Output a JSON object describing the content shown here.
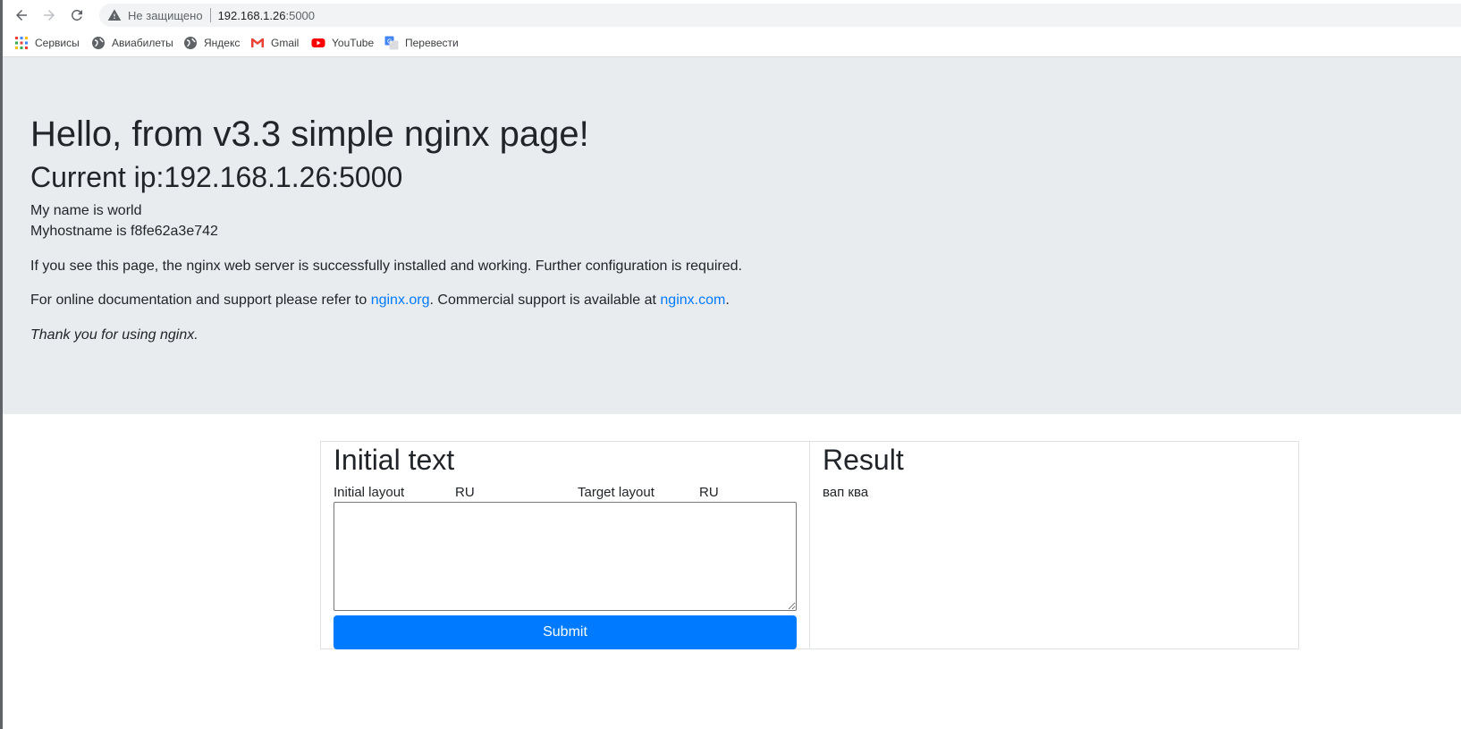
{
  "browser": {
    "security_label": "Не защищено",
    "url_host": "192.168.1.26",
    "url_port": ":5000",
    "bookmarks": [
      {
        "label": "Сервисы",
        "icon": "apps-grid-icon"
      },
      {
        "label": "Авиабилеты",
        "icon": "globe-icon"
      },
      {
        "label": "Яндекс",
        "icon": "globe-icon"
      },
      {
        "label": "Gmail",
        "icon": "gmail-icon"
      },
      {
        "label": "YouTube",
        "icon": "youtube-icon"
      },
      {
        "label": "Перевести",
        "icon": "translate-icon"
      }
    ]
  },
  "page": {
    "title": "Hello, from v3.3 simple nginx page!",
    "current_ip": "Current ip:192.168.1.26:5000",
    "name_line": "My name is world",
    "hostname_line": "Myhostname is f8fe62a3e742",
    "installed_line": "If you see this page, the nginx web server is successfully installed and working. Further configuration is required.",
    "docs": {
      "prefix": "For online documentation and support please refer to ",
      "link1": "nginx.org",
      "middle": ". Commercial support is available at ",
      "link2": "nginx.com",
      "suffix": "."
    },
    "thanks": "Thank you for using nginx."
  },
  "form": {
    "heading": "Initial text",
    "initial_layout_label": "Initial layout",
    "initial_layout_value": "RU",
    "target_layout_label": "Target layout",
    "target_layout_value": "RU",
    "textarea_value": "",
    "submit_label": "Submit"
  },
  "result": {
    "heading": "Result",
    "text": "вап ква"
  },
  "colors": {
    "primary": "#007bff",
    "jumbotron_bg": "#e9ecef",
    "text": "#212529"
  }
}
